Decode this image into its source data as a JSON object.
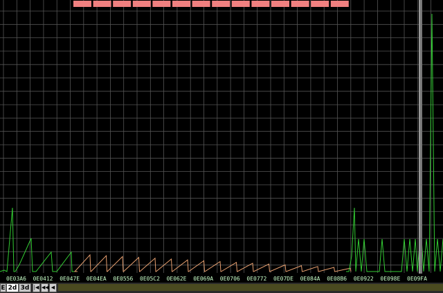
{
  "chart_data": {
    "type": "line",
    "x_tick_labels": [
      "0E03A6",
      "0E0412",
      "0E047E",
      "0E04EA",
      "0E0556",
      "0E05C2",
      "0E062E",
      "0E069A",
      "0E0706",
      "0E0772",
      "0E07DE",
      "0E084A",
      "0E08B6",
      "0E0922",
      "0E098E",
      "0E09FA"
    ],
    "grid": true,
    "series": [
      {
        "color": "#33cc33",
        "segment": "start"
      },
      {
        "color": "#e8a070",
        "segment": "middle"
      },
      {
        "color": "#33cc33",
        "segment": "end"
      }
    ],
    "colors": {
      "background": "#000000",
      "grid": "#555555",
      "axis_text": "#c8ffc8",
      "top_blocks": "#f08080",
      "cursor": "#8a8a8a"
    }
  },
  "tabs": [
    {
      "label": "E"
    },
    {
      "label": "2d"
    },
    {
      "label": "3d"
    }
  ],
  "nav": {
    "first_icon": "skip-first-icon",
    "prev_icon": "rewind-icon",
    "step_icon": "step-back-icon"
  }
}
